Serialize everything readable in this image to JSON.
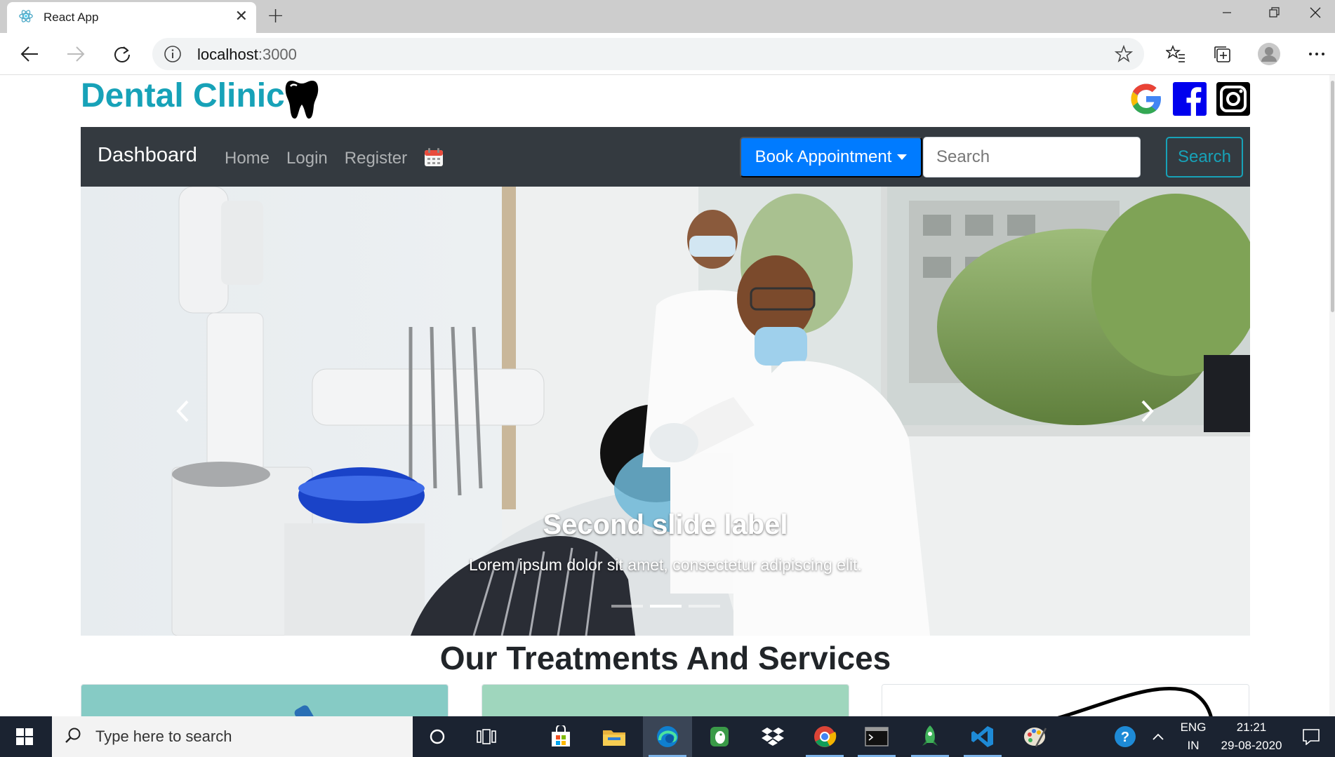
{
  "browser": {
    "tab_title": "React App",
    "address_host": "localhost",
    "address_port": ":3000"
  },
  "page": {
    "brand_title": "Dental Clinic",
    "navbar": {
      "brand": "Dashboard",
      "links": [
        "Home",
        "Login",
        "Register"
      ],
      "book_label": "Book Appointment",
      "search_placeholder": "Search",
      "search_button": "Search"
    },
    "carousel": {
      "caption_title": "Second slide label",
      "caption_text": "Lorem ipsum dolor sit amet, consectetur adipiscing elit.",
      "active_slide": 2,
      "slide_count": 3
    },
    "section_title": "Our Treatments And Services"
  },
  "taskbar": {
    "search_placeholder": "Type here to search",
    "language": "ENG",
    "region": "IN",
    "time": "21:21",
    "date": "29-08-2020"
  },
  "colors": {
    "brand": "#17a2b8",
    "navbar": "#343a40",
    "primary": "#007bff"
  }
}
